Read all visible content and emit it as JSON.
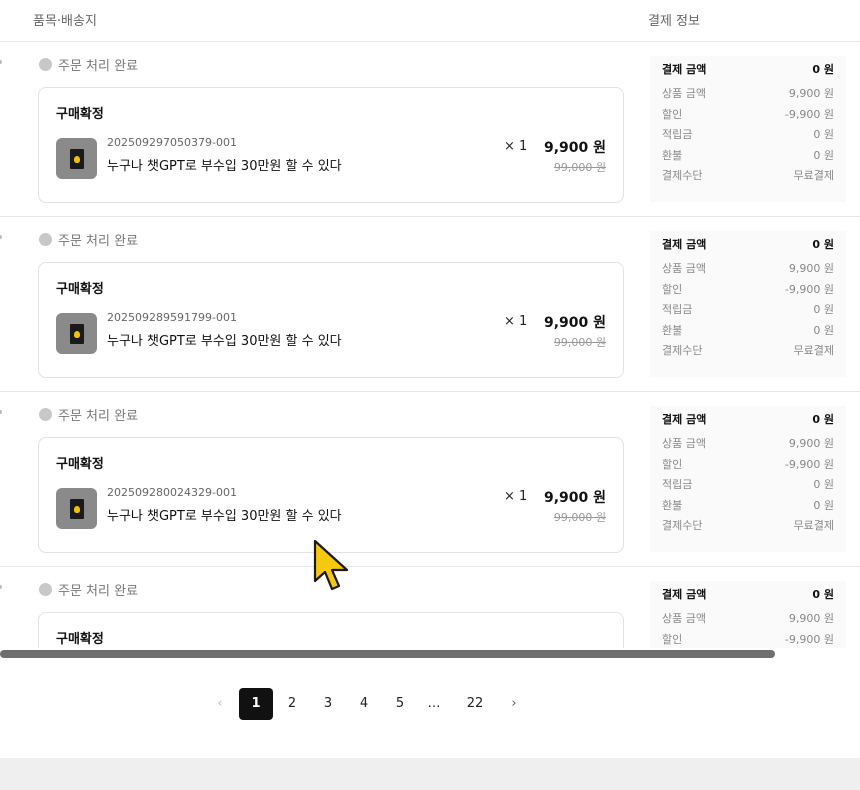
{
  "header": {
    "left": "품목·배송지",
    "right": "결제 정보"
  },
  "orders": [
    {
      "status": "주문 처리 완료",
      "confirm": "구매확정",
      "order_no": "202509297050379-001",
      "product": "누구나 챗GPT로 부수입 30만원 할 수 있다",
      "qty": "× 1",
      "price": "9,900 원",
      "original": "99,000 원",
      "pay": {
        "total_label": "결제 금액",
        "total": "0 원",
        "rows": [
          [
            "상품 금액",
            "9,900 원"
          ],
          [
            "할인",
            "-9,900 원"
          ],
          [
            "적립금",
            "0 원"
          ],
          [
            "환불",
            "0 원"
          ],
          [
            "결제수단",
            "무료결제"
          ]
        ]
      }
    },
    {
      "status": "주문 처리 완료",
      "confirm": "구매확정",
      "order_no": "202509289591799-001",
      "product": "누구나 챗GPT로 부수입 30만원 할 수 있다",
      "qty": "× 1",
      "price": "9,900 원",
      "original": "99,000 원",
      "pay": {
        "total_label": "결제 금액",
        "total": "0 원",
        "rows": [
          [
            "상품 금액",
            "9,900 원"
          ],
          [
            "할인",
            "-9,900 원"
          ],
          [
            "적립금",
            "0 원"
          ],
          [
            "환불",
            "0 원"
          ],
          [
            "결제수단",
            "무료결제"
          ]
        ]
      }
    },
    {
      "status": "주문 처리 완료",
      "confirm": "구매확정",
      "order_no": "202509280024329-001",
      "product": "누구나 챗GPT로 부수입 30만원 할 수 있다",
      "qty": "× 1",
      "price": "9,900 원",
      "original": "99,000 원",
      "pay": {
        "total_label": "결제 금액",
        "total": "0 원",
        "rows": [
          [
            "상품 금액",
            "9,900 원"
          ],
          [
            "할인",
            "-9,900 원"
          ],
          [
            "적립금",
            "0 원"
          ],
          [
            "환불",
            "0 원"
          ],
          [
            "결제수단",
            "무료결제"
          ]
        ]
      }
    },
    {
      "status": "주문 처리 완료",
      "confirm": "구매확정",
      "order_no": "",
      "product": "",
      "qty": "",
      "price": "",
      "original": "",
      "pay": {
        "total_label": "결제 금액",
        "total": "0 원",
        "rows": [
          [
            "상품 금액",
            "9,900 원"
          ],
          [
            "할인",
            "-9,900 원"
          ]
        ]
      }
    }
  ],
  "pagination": {
    "prev": "‹",
    "next": "›",
    "current": "1",
    "pages": [
      "1",
      "2",
      "3",
      "4",
      "5",
      "…",
      "22"
    ]
  },
  "icons": {
    "status_dot": "status-dot-icon",
    "thumbnail": "book-cover-icon",
    "cursor": "pointer-cursor-icon"
  },
  "colors": {
    "active_page": "#111111",
    "scrollbar": "#6e6e6e",
    "cursor_fill": "#f6c90e"
  }
}
